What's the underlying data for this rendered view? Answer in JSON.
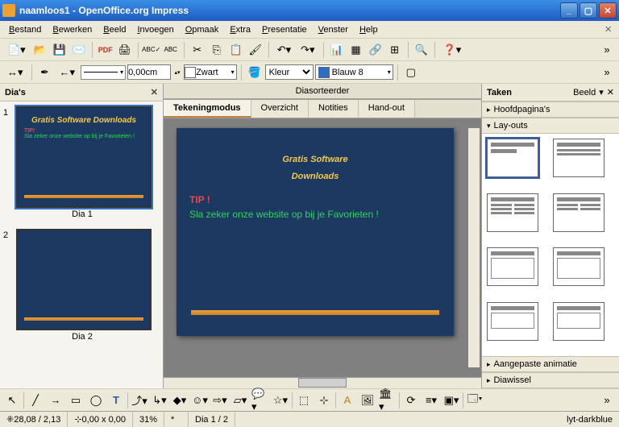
{
  "title": "naamloos1 - OpenOffice.org Impress",
  "menu": [
    "Bestand",
    "Bewerken",
    "Beeld",
    "Invoegen",
    "Opmaak",
    "Extra",
    "Presentatie",
    "Venster",
    "Help"
  ],
  "toolbar2": {
    "line_width": "0,00cm",
    "color_name": "Zwart",
    "fill_mode": "Kleur",
    "fill_color": "Blauw 8",
    "fill_hex": "#2a6ec8",
    "black_hex": "#000000"
  },
  "panels": {
    "slides_title": "Dia's",
    "tasks_title": "Taken",
    "tasks_view_label": "Beeld",
    "masterpages": "Hoofdpagina's",
    "layouts": "Lay-outs",
    "custom_anim": "Aangepaste animatie",
    "slide_trans": "Diawissel"
  },
  "tabs": {
    "sorter": "Diasorteerder",
    "drawing": "Tekeningmodus",
    "outline": "Overzicht",
    "notes": "Notities",
    "handout": "Hand-out"
  },
  "slides": [
    {
      "label": "Dia 1",
      "title": "Gratis Software Downloads",
      "tip": "TIP!",
      "sub": "Sla zeker onze website op bij je Favorieten !"
    },
    {
      "label": "Dia 2",
      "title": "",
      "tip": "",
      "sub": ""
    }
  ],
  "current_slide": {
    "title_line1": "Gratis Software",
    "title_line2": "Downloads",
    "tip": "TIP !",
    "sub": "Sla zeker onze website op bij je Favorieten !"
  },
  "status": {
    "pos": "28,08 / 2,13",
    "size": "0,00 x 0,00",
    "zoom": "31%",
    "slide": "Dia 1 / 2",
    "layout": "lyt-darkblue"
  }
}
